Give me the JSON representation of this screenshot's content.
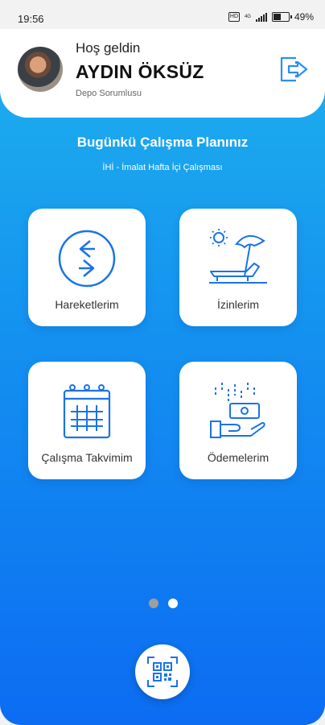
{
  "status_bar": {
    "time": "19:56",
    "sim": "HD",
    "network": "4G",
    "battery": "49%"
  },
  "header": {
    "greeting": "Hoş geldin",
    "name": "AYDIN ÖKSÜZ",
    "role": "Depo Sorumlusu"
  },
  "plan": {
    "title": "Bugünkü Çalışma Planınız",
    "subtitle": "İHİ - İmalat Hafta İçi Çalışması"
  },
  "tiles": [
    {
      "label": "Hareketlerim",
      "icon": "movement-arrows-icon"
    },
    {
      "label": "İzinlerim",
      "icon": "beach-umbrella-icon"
    },
    {
      "label": "Çalışma Takvimim",
      "icon": "calendar-icon"
    },
    {
      "label": "Ödemelerim",
      "icon": "payment-hand-icon"
    }
  ],
  "pager": {
    "count": 2,
    "active_index": 0
  },
  "colors": {
    "accent": "#1a73e8",
    "gradient_top": "#1fb4ec",
    "gradient_bottom": "#0c6cf2",
    "dot_active": "#9e9e9e",
    "dot_inactive": "#ffffff"
  }
}
